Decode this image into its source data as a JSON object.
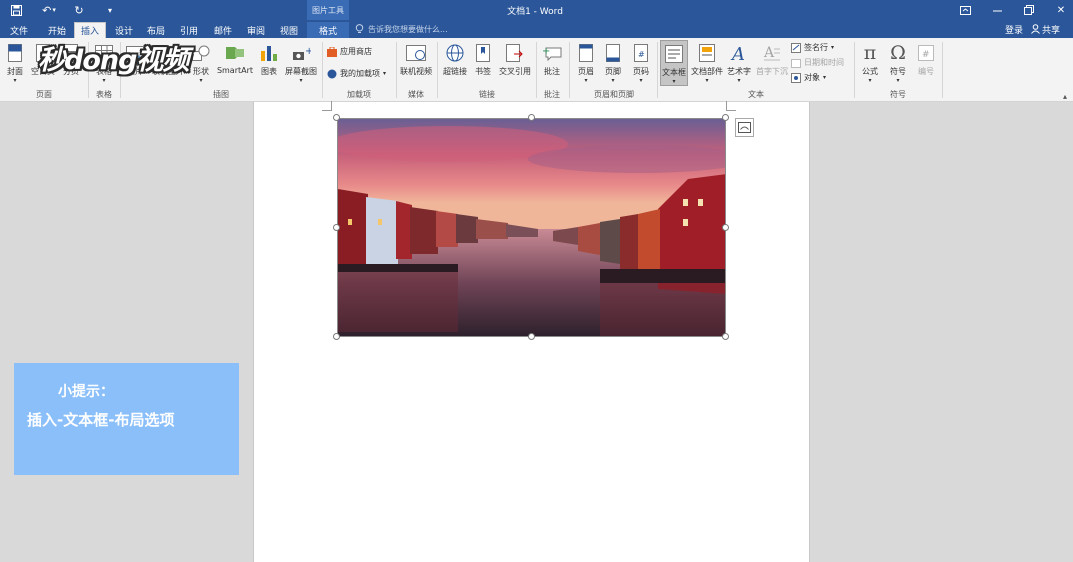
{
  "titlebar": {
    "save_icon": "save-icon",
    "undo_icon": "undo-icon",
    "redo_icon": "redo-icon",
    "customize_icon": "qat-customize-icon",
    "picture_tools": "图片工具",
    "title": "文档1 - Word",
    "ribbon_display_icon": "ribbon-display-icon",
    "restore_icon": "restore-icon",
    "close_label": "✕"
  },
  "tabs": [
    {
      "label": "文件"
    },
    {
      "label": "开始"
    },
    {
      "label": "插入"
    },
    {
      "label": "设计"
    },
    {
      "label": "布局"
    },
    {
      "label": "引用"
    },
    {
      "label": "邮件"
    },
    {
      "label": "审阅"
    },
    {
      "label": "视图"
    },
    {
      "label": "格式"
    }
  ],
  "tellme": {
    "placeholder": "告诉我您想要做什么..."
  },
  "account": {
    "login": "登录",
    "share": "共享"
  },
  "ribbon": {
    "pages": {
      "cover": "封面",
      "blank": "空白页",
      "break": "分页",
      "group": "页面"
    },
    "tables": {
      "table": "表格",
      "group": "表格"
    },
    "illustrations": {
      "picture": "图片",
      "online_picture": "联机图片",
      "shapes": "形状",
      "smartart": "SmartArt",
      "chart": "图表",
      "screenshot": "屏幕截图",
      "group": "插图"
    },
    "addins": {
      "store": "应用商店",
      "my_addins": "我的加载项",
      "group": "加载项"
    },
    "media": {
      "online_video": "联机视频",
      "group": "媒体"
    },
    "links": {
      "hyperlink": "超链接",
      "bookmark": "书签",
      "cross_ref": "交叉引用",
      "group": "链接"
    },
    "comments": {
      "comment": "批注",
      "group": "批注"
    },
    "header_footer": {
      "header": "页眉",
      "footer": "页脚",
      "page_number": "页码",
      "group": "页眉和页脚"
    },
    "text": {
      "textbox": "文本框",
      "quick_parts": "文档部件",
      "wordart": "艺术字",
      "dropcap": "首字下沉",
      "signature": "签名行",
      "datetime": "日期和时间",
      "object": "对象",
      "group": "文本"
    },
    "symbols": {
      "equation": "公式",
      "symbol": "符号",
      "number": "编号",
      "group": "符号"
    }
  },
  "tip": {
    "title": "小提示：",
    "text": "插入-文本框-布局选项"
  },
  "watermark": {
    "text": "秒dong视频"
  },
  "colors": {
    "accent": "#2b579a",
    "tip_bg": "#8bbffa"
  }
}
